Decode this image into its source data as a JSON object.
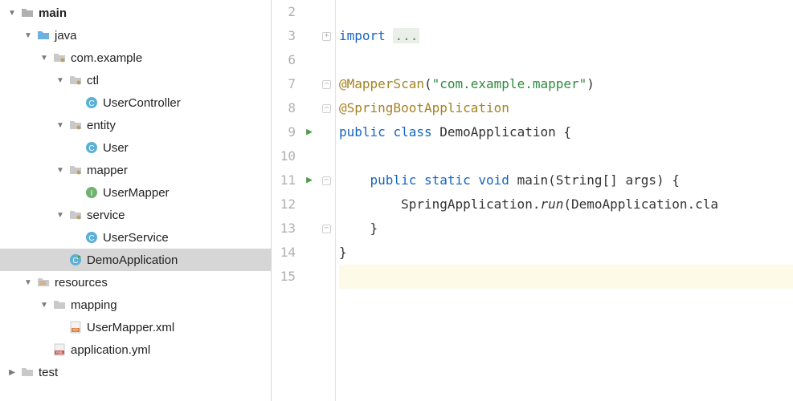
{
  "tree": {
    "main": "main",
    "java": "java",
    "pkg": "com.example",
    "ctl": "ctl",
    "userController": "UserController",
    "entity": "entity",
    "user": "User",
    "mapper": "mapper",
    "userMapper": "UserMapper",
    "service": "service",
    "userService": "UserService",
    "demoApp": "DemoApplication",
    "resources": "resources",
    "mapping": "mapping",
    "userMapperXml": "UserMapper.xml",
    "appYml": "application.yml",
    "test": "test"
  },
  "editor": {
    "lines": [
      "2",
      "3",
      "6",
      "7",
      "8",
      "9",
      "10",
      "11",
      "12",
      "13",
      "14",
      "15"
    ],
    "l3_kw": "import",
    "l3_dots": "...",
    "l7_ann": "@MapperScan",
    "l7_str": "\"com.example.mapper\"",
    "l8_ann": "@SpringBootApplication",
    "l9_kw1": "public",
    "l9_kw2": "class",
    "l9_name": "DemoApplication {",
    "l11_kw1": "public",
    "l11_kw2": "static",
    "l11_kw3": "void",
    "l11_main": "main",
    "l11_rest": "(String[] args) {",
    "l12_a": "SpringApplication.",
    "l12_run": "run",
    "l12_b": "(DemoApplication.cla",
    "l13": "}",
    "l14": "}"
  }
}
